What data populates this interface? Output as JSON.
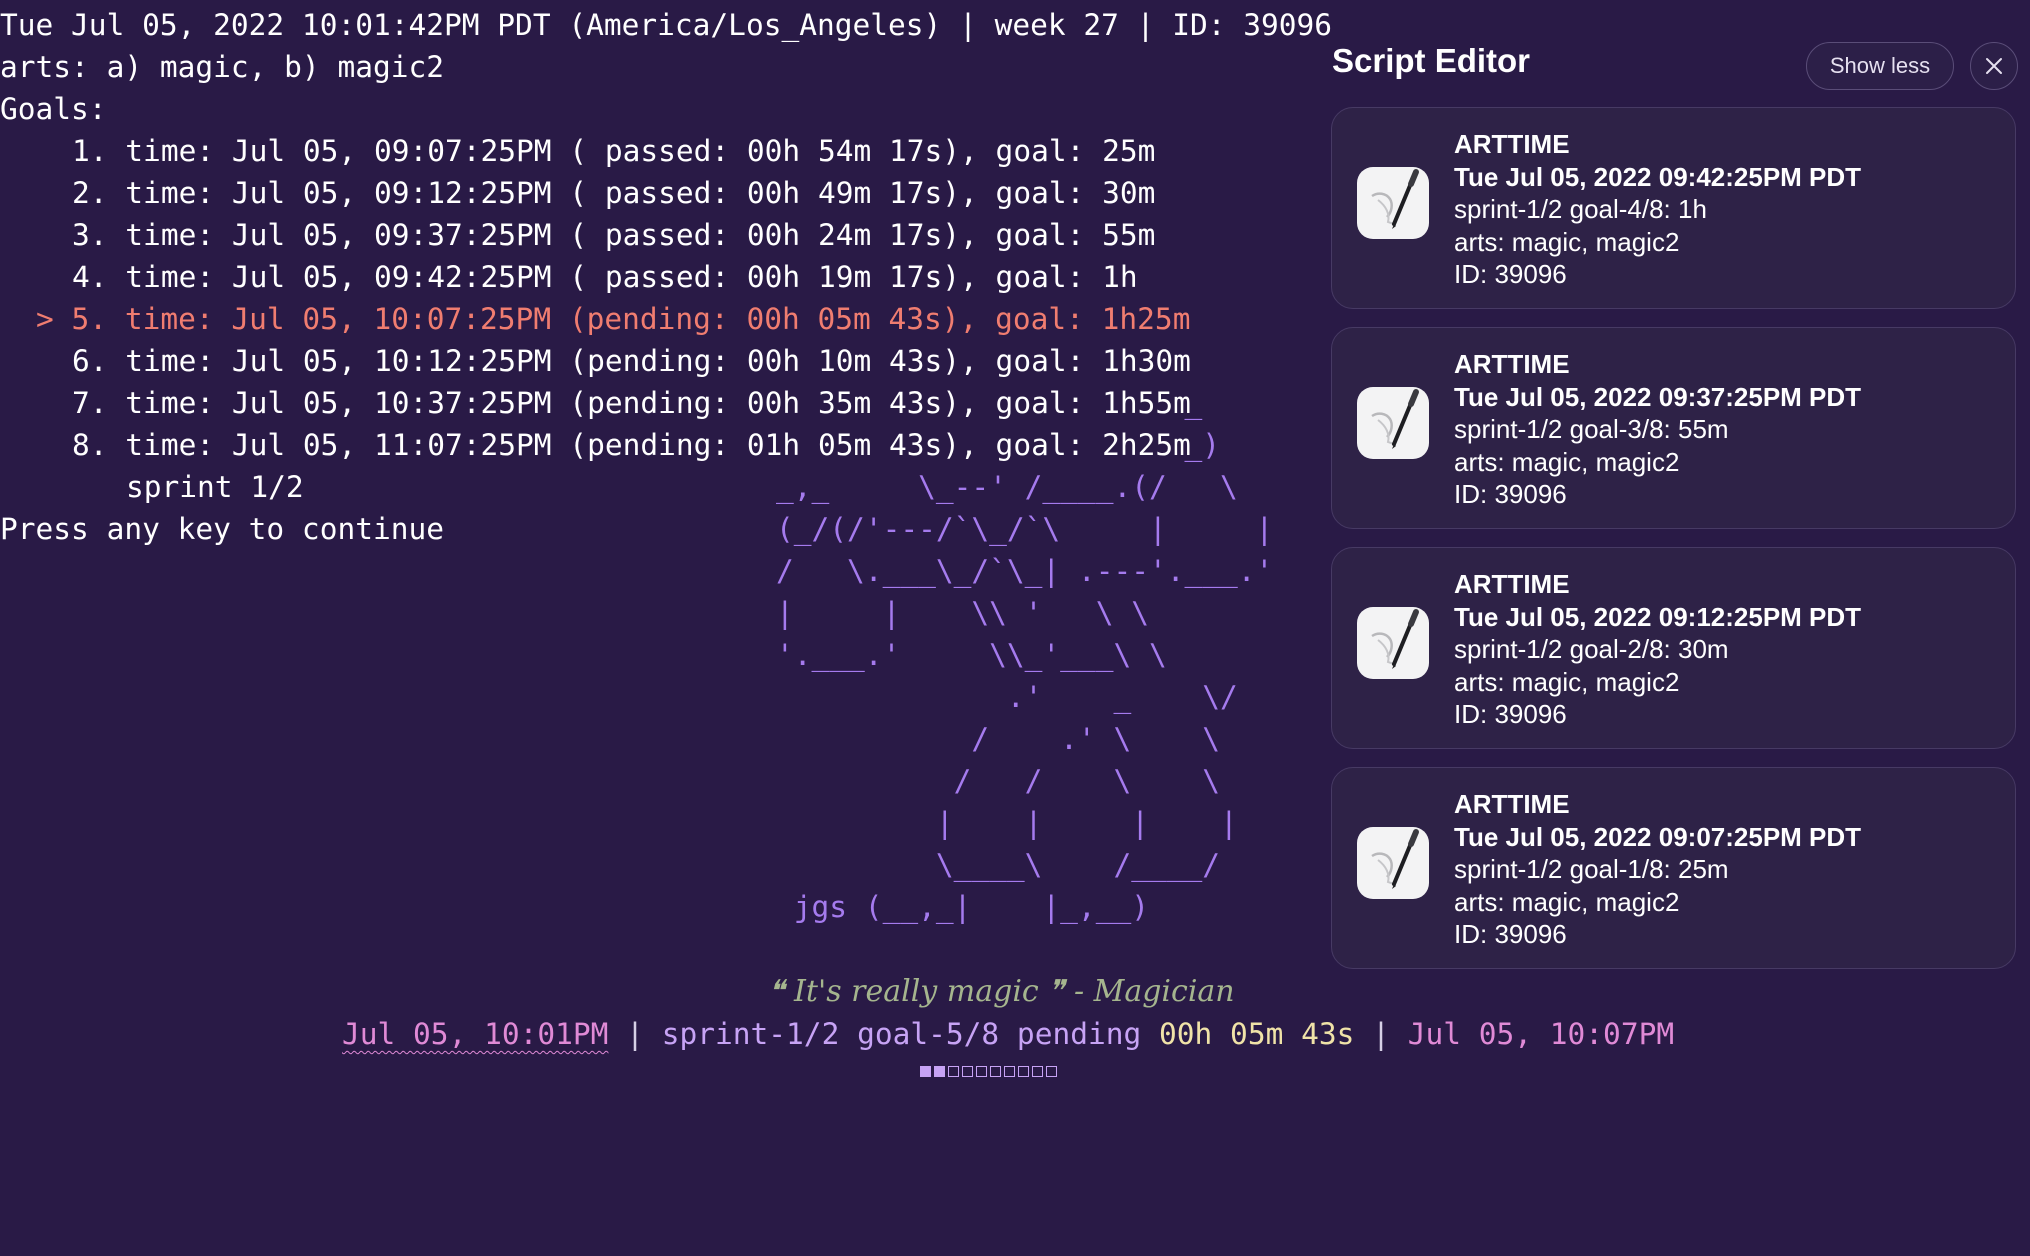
{
  "terminal": {
    "header_line": "Tue Jul 05, 2022 10:01:42PM PDT (America/Los_Angeles) | week 27 | ID: 39096",
    "arts_line": "arts: a) magic, b) magic2",
    "goals_heading": "Goals:",
    "active_marker": ">",
    "goals": [
      {
        "num": "1.",
        "text": "time: Jul 05, 09:07:25PM ( passed: 00h 54m 17s), goal: 25m"
      },
      {
        "num": "2.",
        "text": "time: Jul 05, 09:12:25PM ( passed: 00h 49m 17s), goal: 30m"
      },
      {
        "num": "3.",
        "text": "time: Jul 05, 09:37:25PM ( passed: 00h 24m 17s), goal: 55m"
      },
      {
        "num": "4.",
        "text": "time: Jul 05, 09:42:25PM ( passed: 00h 19m 17s), goal: 1h"
      },
      {
        "num": "5.",
        "text": "time: Jul 05, 10:07:25PM (pending: 00h 05m 43s), goal: 1h25m"
      },
      {
        "num": "6.",
        "text": "time: Jul 05, 10:12:25PM (pending: 00h 10m 43s), goal: 1h30m"
      },
      {
        "num": "7.",
        "text": "time: Jul 05, 10:37:25PM (pending: 00h 35m 43s), goal: 1h55m"
      },
      {
        "num": "8.",
        "text": "time: Jul 05, 11:07:25PM (pending: 01h 05m 43s), goal: 2h25m"
      }
    ],
    "sprint_line": "sprint 1/2",
    "press_key": "Press any key to continue",
    "ascii_art": "                       _\n                       _)\n_,_     \\_--' /____.(/   \\\n(_/(/'---/`\\_/`\\     |     |\n/   \\.___\\_/`\\_| .---'.___.'\n|     |    \\\\ '   \\ \\\n'.___.'     \\\\_'___\\ \\\n             .'    _    \\/\n           /    .' \\    \\\n          /   /    \\    \\\n         |    |     |    |\n         \\____\\    /____/\n jgs (__,_|    |_,__)",
    "quote": "❝ It's really magic ❞ - Magician",
    "status": {
      "start_time": "Jul 05, 10:01PM",
      "sep1": " | ",
      "sprint_goal": "sprint-1/2 goal-5/8 pending ",
      "countdown": "00h 05m 43s",
      "sep2": " | ",
      "end_time": "Jul 05, 10:07PM"
    },
    "progress": {
      "filled": 2,
      "total": 10
    }
  },
  "panel": {
    "title": "Script Editor",
    "show_less_label": "Show less",
    "close_icon": "close-icon",
    "notification_icon": "script-editor-icon",
    "notifications": [
      {
        "app": "ARTTIME",
        "datetime": "Tue Jul 05, 2022 09:42:25PM PDT",
        "goal": "sprint-1/2 goal-4/8: 1h",
        "arts": "arts: magic, magic2",
        "id": "ID: 39096"
      },
      {
        "app": "ARTTIME",
        "datetime": "Tue Jul 05, 2022 09:37:25PM PDT",
        "goal": "sprint-1/2 goal-3/8: 55m",
        "arts": "arts: magic, magic2",
        "id": "ID: 39096"
      },
      {
        "app": "ARTTIME",
        "datetime": "Tue Jul 05, 2022 09:12:25PM PDT",
        "goal": "sprint-1/2 goal-2/8: 30m",
        "arts": "arts: magic, magic2",
        "id": "ID: 39096"
      },
      {
        "app": "ARTTIME",
        "datetime": "Tue Jul 05, 2022 09:07:25PM PDT",
        "goal": "sprint-1/2 goal-1/8: 25m",
        "arts": "arts: magic, magic2",
        "id": "ID: 39096"
      }
    ]
  },
  "colors": {
    "background": "#291a46",
    "terminal_text": "#ffffff",
    "active_goal": "#f07d70",
    "ascii_art": "#a57bee",
    "quote": "#a5b58e",
    "time_pink": "#e08ad6",
    "sprint_lavender": "#c7a3f5",
    "countdown_yellow": "#f0e3a8",
    "notification_bg": "#2e2247"
  }
}
